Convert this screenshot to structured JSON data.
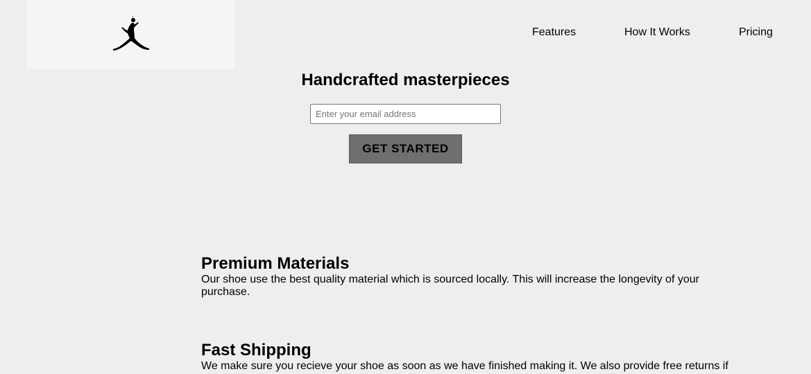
{
  "header": {
    "logo_icon": "jumpman-logo-icon",
    "nav": [
      {
        "label": "Features"
      },
      {
        "label": "How It Works"
      },
      {
        "label": "Pricing"
      }
    ]
  },
  "hero": {
    "title": "Handcrafted masterpieces",
    "email_placeholder": "Enter your email address",
    "cta_label": "GET STARTED"
  },
  "features": [
    {
      "title": "Premium Materials",
      "text": "Our shoe use the best quality material which is sourced locally. This will increase the longevity of your purchase."
    },
    {
      "title": "Fast Shipping",
      "text": "We make sure you recieve your shoe as soon as we have finished making it. We also provide free returns if you"
    }
  ],
  "colors": {
    "background": "#eeeeee",
    "logo_box": "#f5f5f5",
    "button": "#6f6f6f"
  }
}
